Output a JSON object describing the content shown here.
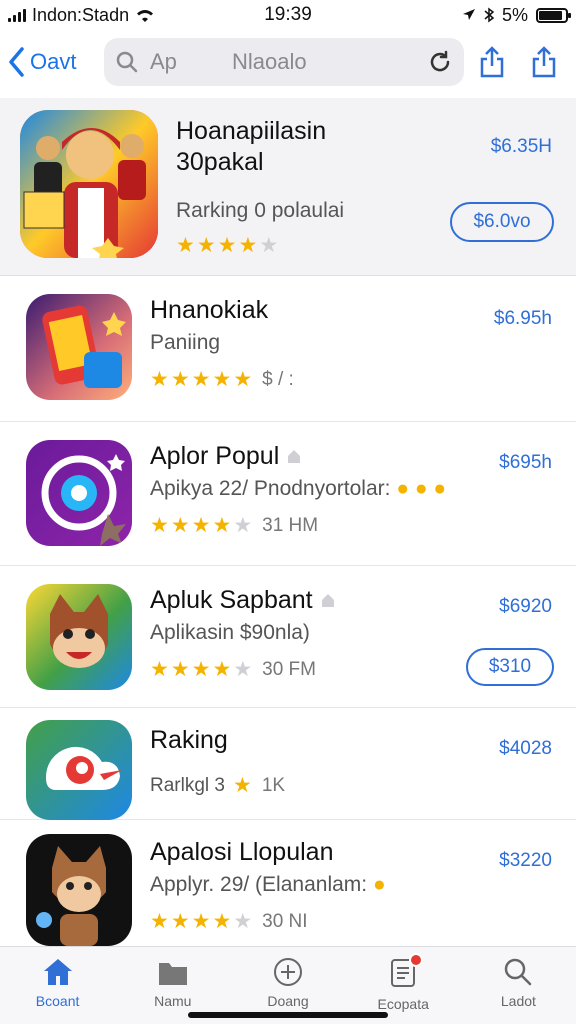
{
  "status_bar": {
    "carrier": "Indon:Stadn",
    "time": "19:39",
    "battery": "5%",
    "battery_level": 0.9
  },
  "nav": {
    "back_label": "Oavt",
    "search_query": "Ap",
    "search_value": "Nlaoalo"
  },
  "featured": {
    "title": "Hoanapiilasin",
    "subtitle": "30pakal",
    "line": "Rarking 0 polaulai",
    "rating": 4,
    "price": "$6.35H",
    "button": "$6.0vo"
  },
  "apps": [
    {
      "title": "Hnanokiak",
      "subtitle": "Paniing",
      "rating": 5,
      "meta": "$ / :",
      "price": "$6.95h"
    },
    {
      "title": "Aplor Popul",
      "subtitle": "Apikya 22/ Pnodnyortolar:",
      "rating": 4,
      "meta": "31 HM",
      "price": "$695h"
    },
    {
      "title": "Apluk Sapbant",
      "subtitle": "Aplikasin $90nla)",
      "rating": 4,
      "meta": "30 FM",
      "price": "$6920",
      "button": "$310"
    },
    {
      "title": "Raking",
      "subtitle": "",
      "line": "Rarlkgl 3",
      "meta": "1K",
      "price": "$4028"
    },
    {
      "title": "Apalosi Llopulan",
      "subtitle": "Applyr. 29/ (Elananlam:",
      "rating": 4,
      "meta": "30 NI",
      "price": "$3220"
    }
  ],
  "tabs": [
    {
      "label": "Bcoant",
      "icon": "home-icon"
    },
    {
      "label": "Namu",
      "icon": "folder-icon"
    },
    {
      "label": "Doang",
      "icon": "plus-circle-icon"
    },
    {
      "label": "Ecopata",
      "icon": "clipboard-icon"
    },
    {
      "label": "Ladot",
      "icon": "search-icon"
    }
  ],
  "colors": {
    "accent": "#2f6fd6",
    "star": "#f5b301"
  }
}
